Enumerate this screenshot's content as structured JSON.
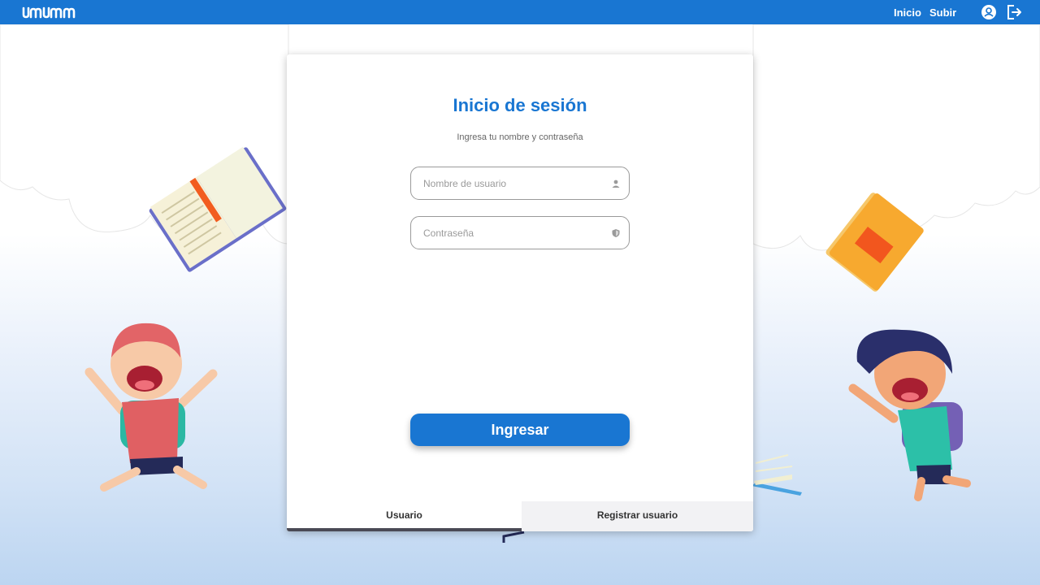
{
  "nav": {
    "links": [
      "Inicio",
      "Subir"
    ],
    "icons": [
      "logo",
      "user-icon",
      "logout-icon"
    ]
  },
  "login": {
    "title": "Inicio de sesión",
    "subtitle": "Ingresa tu nombre y contraseña",
    "username_placeholder": "Nombre de usuario",
    "password_placeholder": "Contraseña",
    "submit_label": "Ingresar"
  },
  "tabs": {
    "usuario": "Usuario",
    "registrar": "Registrar usuario",
    "active": "Usuario"
  },
  "colors": {
    "primary": "#1976d2",
    "tab_underline": "#4a4a55"
  }
}
